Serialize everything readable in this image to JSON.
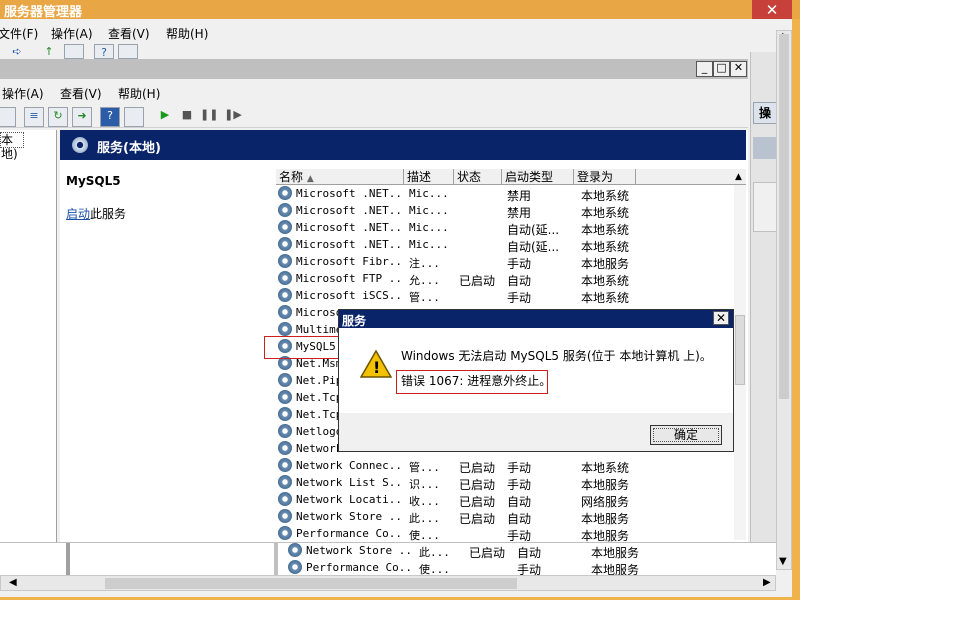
{
  "outer_window": {
    "title": "服务器管理器",
    "close_glyph": "✕",
    "menu": [
      "文件(F)",
      "操作(A)",
      "查看(V)",
      "帮助(H)"
    ],
    "right_pane_label": "操"
  },
  "mmc": {
    "menu": [
      "操作(A)",
      "查看(V)",
      "帮助(H)"
    ],
    "tree_item": "本地)",
    "header": "服务(本地)",
    "selected_service_title": "MySQL5",
    "start_link": "启动",
    "start_link_suffix": "此服务"
  },
  "columns": [
    "名称",
    "描述",
    "状态",
    "启动类型",
    "登录为"
  ],
  "services": [
    {
      "name": "Microsoft .NET...",
      "desc": "Mic...",
      "state": "",
      "startup": "禁用",
      "logon": "本地系统"
    },
    {
      "name": "Microsoft .NET...",
      "desc": "Mic...",
      "state": "",
      "startup": "禁用",
      "logon": "本地系统"
    },
    {
      "name": "Microsoft .NET...",
      "desc": "Mic...",
      "state": "",
      "startup": "自动(延...",
      "logon": "本地系统"
    },
    {
      "name": "Microsoft .NET...",
      "desc": "Mic...",
      "state": "",
      "startup": "自动(延...",
      "logon": "本地系统"
    },
    {
      "name": "Microsoft Fibr...",
      "desc": "注...",
      "state": "",
      "startup": "手动",
      "logon": "本地服务"
    },
    {
      "name": "Microsoft FTP ...",
      "desc": "允...",
      "state": "已启动",
      "startup": "自动",
      "logon": "本地系统"
    },
    {
      "name": "Microsoft iSCS...",
      "desc": "管...",
      "state": "",
      "startup": "手动",
      "logon": "本地系统"
    },
    {
      "name": "Microso",
      "desc": "",
      "state": "",
      "startup": "",
      "logon": ""
    },
    {
      "name": "Multime",
      "desc": "",
      "state": "",
      "startup": "",
      "logon": ""
    },
    {
      "name": "MySQL5",
      "desc": "",
      "state": "",
      "startup": "",
      "logon": ""
    },
    {
      "name": "Net.Msm",
      "desc": "",
      "state": "",
      "startup": "",
      "logon": ""
    },
    {
      "name": "Net.Pip",
      "desc": "",
      "state": "",
      "startup": "",
      "logon": ""
    },
    {
      "name": "Net.Tcp",
      "desc": "",
      "state": "",
      "startup": "",
      "logon": ""
    },
    {
      "name": "Net.Tcp",
      "desc": "",
      "state": "",
      "startup": "",
      "logon": ""
    },
    {
      "name": "Netlogo",
      "desc": "",
      "state": "",
      "startup": "",
      "logon": ""
    },
    {
      "name": "Network",
      "desc": "",
      "state": "",
      "startup": "",
      "logon": ""
    },
    {
      "name": "Network Connec...",
      "desc": "管...",
      "state": "已启动",
      "startup": "手动",
      "logon": "本地系统"
    },
    {
      "name": "Network List S...",
      "desc": "识...",
      "state": "已启动",
      "startup": "手动",
      "logon": "本地服务"
    },
    {
      "name": "Network Locati...",
      "desc": "收...",
      "state": "已启动",
      "startup": "自动",
      "logon": "网络服务"
    },
    {
      "name": "Network Store ...",
      "desc": "此...",
      "state": "已启动",
      "startup": "自动",
      "logon": "本地服务"
    },
    {
      "name": "Performance Co...",
      "desc": "使...",
      "state": "",
      "startup": "手动",
      "logon": "本地服务"
    }
  ],
  "ghost_rows": [
    {
      "name": "Network Store ...",
      "desc": "此...",
      "state": "已启动",
      "startup": "自动",
      "logon": "本地服务"
    },
    {
      "name": "Performance Co...",
      "desc": "使...",
      "state": "",
      "startup": "手动",
      "logon": "本地服务"
    }
  ],
  "dialog": {
    "title": "服务",
    "close_glyph": "✕",
    "message": "Windows 无法启动 MySQL5 服务(位于 本地计算机 上)。",
    "error": "错误 1067: 进程意外终止。",
    "ok_label": "确定",
    "warning_glyph": "!"
  }
}
